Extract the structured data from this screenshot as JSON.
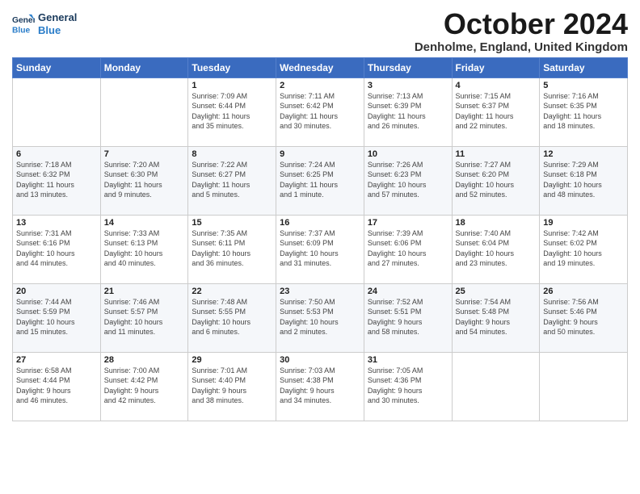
{
  "logo": {
    "line1": "General",
    "line2": "Blue"
  },
  "title": "October 2024",
  "location": "Denholme, England, United Kingdom",
  "days_of_week": [
    "Sunday",
    "Monday",
    "Tuesday",
    "Wednesday",
    "Thursday",
    "Friday",
    "Saturday"
  ],
  "weeks": [
    [
      {
        "day": "",
        "info": ""
      },
      {
        "day": "",
        "info": ""
      },
      {
        "day": "1",
        "info": "Sunrise: 7:09 AM\nSunset: 6:44 PM\nDaylight: 11 hours\nand 35 minutes."
      },
      {
        "day": "2",
        "info": "Sunrise: 7:11 AM\nSunset: 6:42 PM\nDaylight: 11 hours\nand 30 minutes."
      },
      {
        "day": "3",
        "info": "Sunrise: 7:13 AM\nSunset: 6:39 PM\nDaylight: 11 hours\nand 26 minutes."
      },
      {
        "day": "4",
        "info": "Sunrise: 7:15 AM\nSunset: 6:37 PM\nDaylight: 11 hours\nand 22 minutes."
      },
      {
        "day": "5",
        "info": "Sunrise: 7:16 AM\nSunset: 6:35 PM\nDaylight: 11 hours\nand 18 minutes."
      }
    ],
    [
      {
        "day": "6",
        "info": "Sunrise: 7:18 AM\nSunset: 6:32 PM\nDaylight: 11 hours\nand 13 minutes."
      },
      {
        "day": "7",
        "info": "Sunrise: 7:20 AM\nSunset: 6:30 PM\nDaylight: 11 hours\nand 9 minutes."
      },
      {
        "day": "8",
        "info": "Sunrise: 7:22 AM\nSunset: 6:27 PM\nDaylight: 11 hours\nand 5 minutes."
      },
      {
        "day": "9",
        "info": "Sunrise: 7:24 AM\nSunset: 6:25 PM\nDaylight: 11 hours\nand 1 minute."
      },
      {
        "day": "10",
        "info": "Sunrise: 7:26 AM\nSunset: 6:23 PM\nDaylight: 10 hours\nand 57 minutes."
      },
      {
        "day": "11",
        "info": "Sunrise: 7:27 AM\nSunset: 6:20 PM\nDaylight: 10 hours\nand 52 minutes."
      },
      {
        "day": "12",
        "info": "Sunrise: 7:29 AM\nSunset: 6:18 PM\nDaylight: 10 hours\nand 48 minutes."
      }
    ],
    [
      {
        "day": "13",
        "info": "Sunrise: 7:31 AM\nSunset: 6:16 PM\nDaylight: 10 hours\nand 44 minutes."
      },
      {
        "day": "14",
        "info": "Sunrise: 7:33 AM\nSunset: 6:13 PM\nDaylight: 10 hours\nand 40 minutes."
      },
      {
        "day": "15",
        "info": "Sunrise: 7:35 AM\nSunset: 6:11 PM\nDaylight: 10 hours\nand 36 minutes."
      },
      {
        "day": "16",
        "info": "Sunrise: 7:37 AM\nSunset: 6:09 PM\nDaylight: 10 hours\nand 31 minutes."
      },
      {
        "day": "17",
        "info": "Sunrise: 7:39 AM\nSunset: 6:06 PM\nDaylight: 10 hours\nand 27 minutes."
      },
      {
        "day": "18",
        "info": "Sunrise: 7:40 AM\nSunset: 6:04 PM\nDaylight: 10 hours\nand 23 minutes."
      },
      {
        "day": "19",
        "info": "Sunrise: 7:42 AM\nSunset: 6:02 PM\nDaylight: 10 hours\nand 19 minutes."
      }
    ],
    [
      {
        "day": "20",
        "info": "Sunrise: 7:44 AM\nSunset: 5:59 PM\nDaylight: 10 hours\nand 15 minutes."
      },
      {
        "day": "21",
        "info": "Sunrise: 7:46 AM\nSunset: 5:57 PM\nDaylight: 10 hours\nand 11 minutes."
      },
      {
        "day": "22",
        "info": "Sunrise: 7:48 AM\nSunset: 5:55 PM\nDaylight: 10 hours\nand 6 minutes."
      },
      {
        "day": "23",
        "info": "Sunrise: 7:50 AM\nSunset: 5:53 PM\nDaylight: 10 hours\nand 2 minutes."
      },
      {
        "day": "24",
        "info": "Sunrise: 7:52 AM\nSunset: 5:51 PM\nDaylight: 9 hours\nand 58 minutes."
      },
      {
        "day": "25",
        "info": "Sunrise: 7:54 AM\nSunset: 5:48 PM\nDaylight: 9 hours\nand 54 minutes."
      },
      {
        "day": "26",
        "info": "Sunrise: 7:56 AM\nSunset: 5:46 PM\nDaylight: 9 hours\nand 50 minutes."
      }
    ],
    [
      {
        "day": "27",
        "info": "Sunrise: 6:58 AM\nSunset: 4:44 PM\nDaylight: 9 hours\nand 46 minutes."
      },
      {
        "day": "28",
        "info": "Sunrise: 7:00 AM\nSunset: 4:42 PM\nDaylight: 9 hours\nand 42 minutes."
      },
      {
        "day": "29",
        "info": "Sunrise: 7:01 AM\nSunset: 4:40 PM\nDaylight: 9 hours\nand 38 minutes."
      },
      {
        "day": "30",
        "info": "Sunrise: 7:03 AM\nSunset: 4:38 PM\nDaylight: 9 hours\nand 34 minutes."
      },
      {
        "day": "31",
        "info": "Sunrise: 7:05 AM\nSunset: 4:36 PM\nDaylight: 9 hours\nand 30 minutes."
      },
      {
        "day": "",
        "info": ""
      },
      {
        "day": "",
        "info": ""
      }
    ]
  ]
}
